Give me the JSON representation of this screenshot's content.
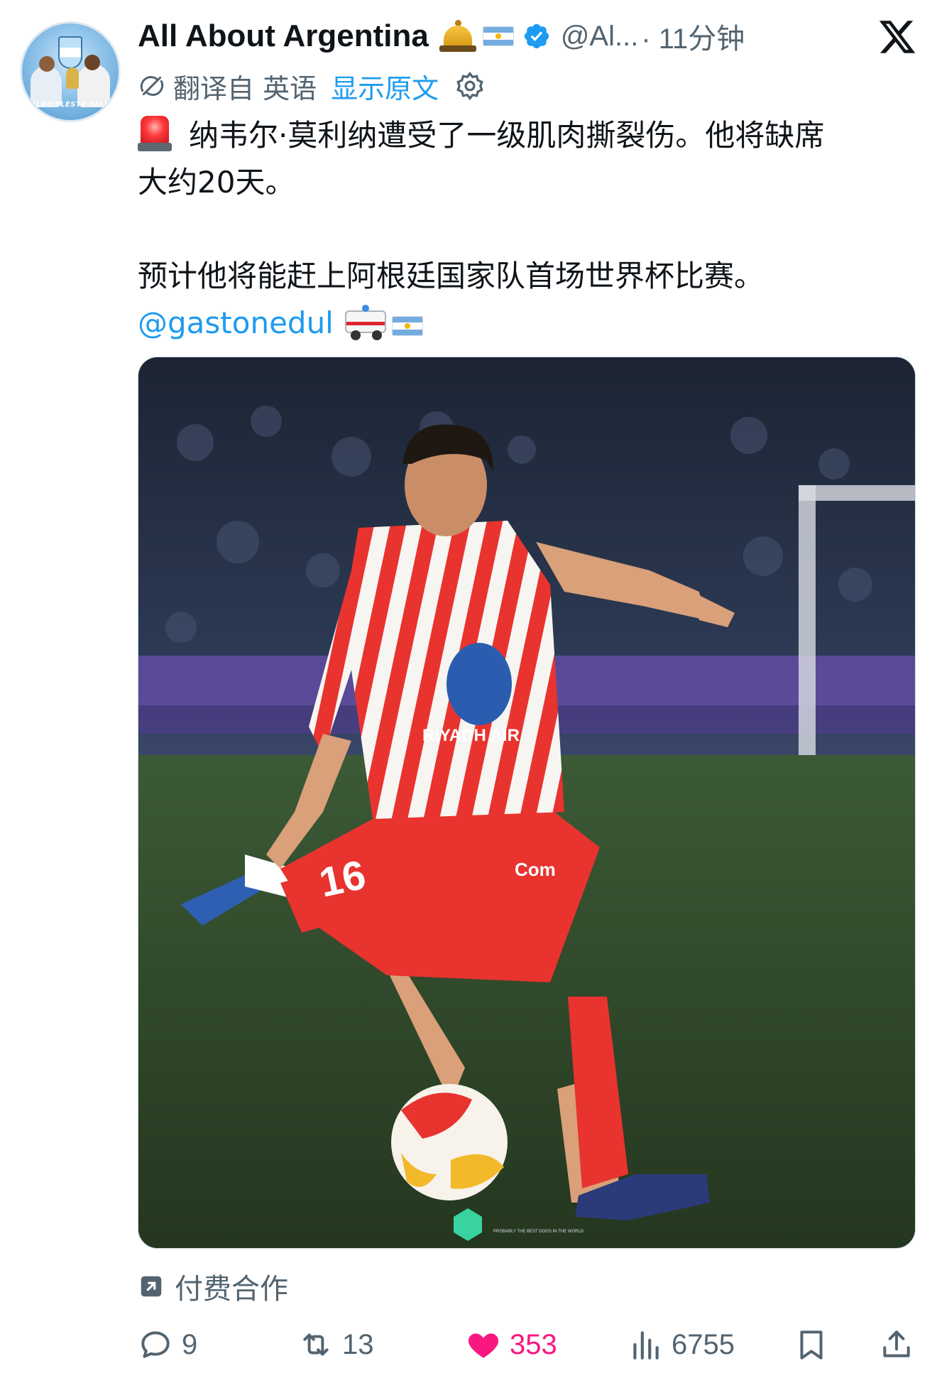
{
  "account": {
    "name": "All About Argentina",
    "handle": "@Al...",
    "time": "· 11分钟",
    "avatar_text": "ALBICELESTE TALK"
  },
  "translation": {
    "label": "翻译自 英语",
    "show_original": "显示原文"
  },
  "tweet": {
    "line1": "纳韦尔·莫利纳遭受了一级肌肉撕裂伤。他将缺席",
    "line2": "大约20天。",
    "line3": "预计他将能赶上阿根廷国家队首场世界杯比赛。",
    "mention": "@gastonedul"
  },
  "media": {
    "jersey_sponsor": "RIYADH AIR",
    "shorts_number": "16",
    "shorts_sponsor": "Com",
    "watermark": "PROBABLY THE BEST DOGS IN THE WORLD"
  },
  "paid_partnership": {
    "label": "付费合作"
  },
  "actions": {
    "replies": "9",
    "reposts": "13",
    "likes": "353",
    "views": "6755"
  },
  "colors": {
    "accent": "#1d9bf0",
    "like": "#f91880",
    "muted": "#536471",
    "text": "#0f1419"
  },
  "icons": [
    "verified-badge-icon",
    "x-logo-icon",
    "translate-icon",
    "gear-icon",
    "siren-emoji",
    "ambulance-emoji",
    "argentina-flag-emoji",
    "bell-emoji",
    "paid-partnership-icon",
    "reply-icon",
    "repost-icon",
    "heart-icon",
    "views-icon",
    "bookmark-icon",
    "share-icon"
  ]
}
